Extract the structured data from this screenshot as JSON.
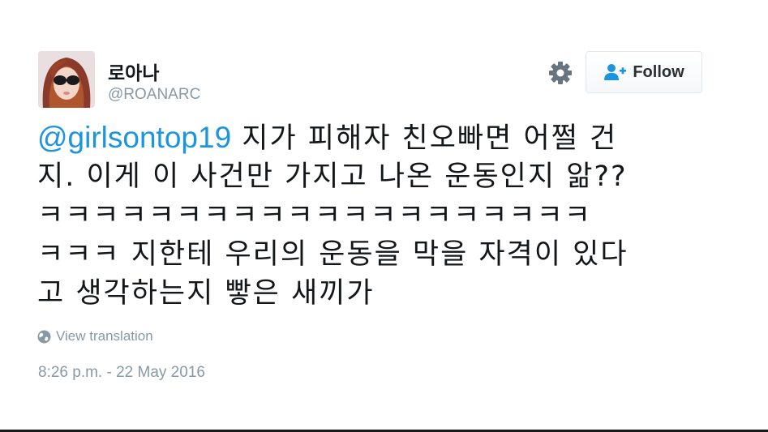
{
  "user": {
    "display_name": "로아나",
    "username": "@ROANARC",
    "avatar_icon": "profile-photo"
  },
  "actions": {
    "settings_icon": "gear-icon",
    "follow_label": "Follow",
    "follow_icon": "add-user-icon"
  },
  "tweet": {
    "mention": "@girlsontop19",
    "lines": [
      " 지가 피해자 친오빠면 어쩔 건",
      "지. 이게 이 사건만 가지고 나온 운동인지 앎??",
      "ㅋㅋㅋㅋㅋㅋㅋㅋㅋㅋㅋㅋㅋㅋㅋㅋㅋㅋㅋㅋ",
      "ㅋㅋㅋ 지한테 우리의 운동을 막을 자격이 있다",
      "고 생각하는지 빻은 새끼가"
    ],
    "translate_label": "View translation",
    "timestamp": "8:26 p.m. - 22 May 2016"
  },
  "colors": {
    "link": "#1b95e0",
    "muted": "#8899a6",
    "text": "#14171a",
    "button_border": "#e1e8ed"
  }
}
